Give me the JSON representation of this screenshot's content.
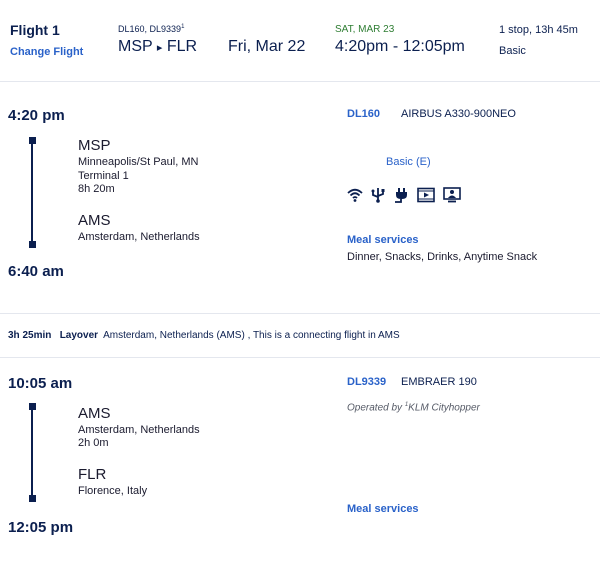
{
  "header": {
    "flight_label": "Flight 1",
    "change_flight": "Change Flight",
    "flight_numbers": "DL160, DL9339",
    "flight_numbers_sup": "1",
    "origin": "MSP",
    "destination": "FLR",
    "route_separator": "▸",
    "depart_date": "Fri, Mar 22",
    "arrive_date": "SAT, MAR 23",
    "time_range": "4:20pm - 12:05pm",
    "stops_duration": "1 stop, 13h 45m",
    "fare_class": "Basic"
  },
  "segments": [
    {
      "depart_time": "4:20 pm",
      "arrive_time": "6:40 am",
      "from_code": "MSP",
      "from_city": "Minneapolis/St Paul, MN",
      "from_terminal": "Terminal 1",
      "duration": "8h 20m",
      "to_code": "AMS",
      "to_city": "Amsterdam, Netherlands",
      "flight_no": "DL160",
      "aircraft": "AIRBUS A330-900NEO",
      "cabin": "Basic (E)",
      "amenities": [
        "wifi-icon",
        "usb-icon",
        "power-icon",
        "video-icon",
        "seatback-screen-icon"
      ],
      "meal_label": "Meal services",
      "meals": "Dinner, Snacks, Drinks, Anytime Snack"
    },
    {
      "depart_time": "10:05 am",
      "arrive_time": "12:05 pm",
      "from_code": "AMS",
      "from_city": "Amsterdam, Netherlands",
      "duration": "2h 0m",
      "to_code": "FLR",
      "to_city": "Florence, Italy",
      "flight_no": "DL9339",
      "aircraft": "EMBRAER 190",
      "operated_prefix": "Operated by ",
      "operated_sup": "1",
      "operated_by": "KLM Cityhopper",
      "meal_label": "Meal services"
    }
  ],
  "layover": {
    "duration": "3h 25min",
    "label": "Layover",
    "text": "Amsterdam, Netherlands (AMS) , This is a connecting flight in AMS"
  }
}
